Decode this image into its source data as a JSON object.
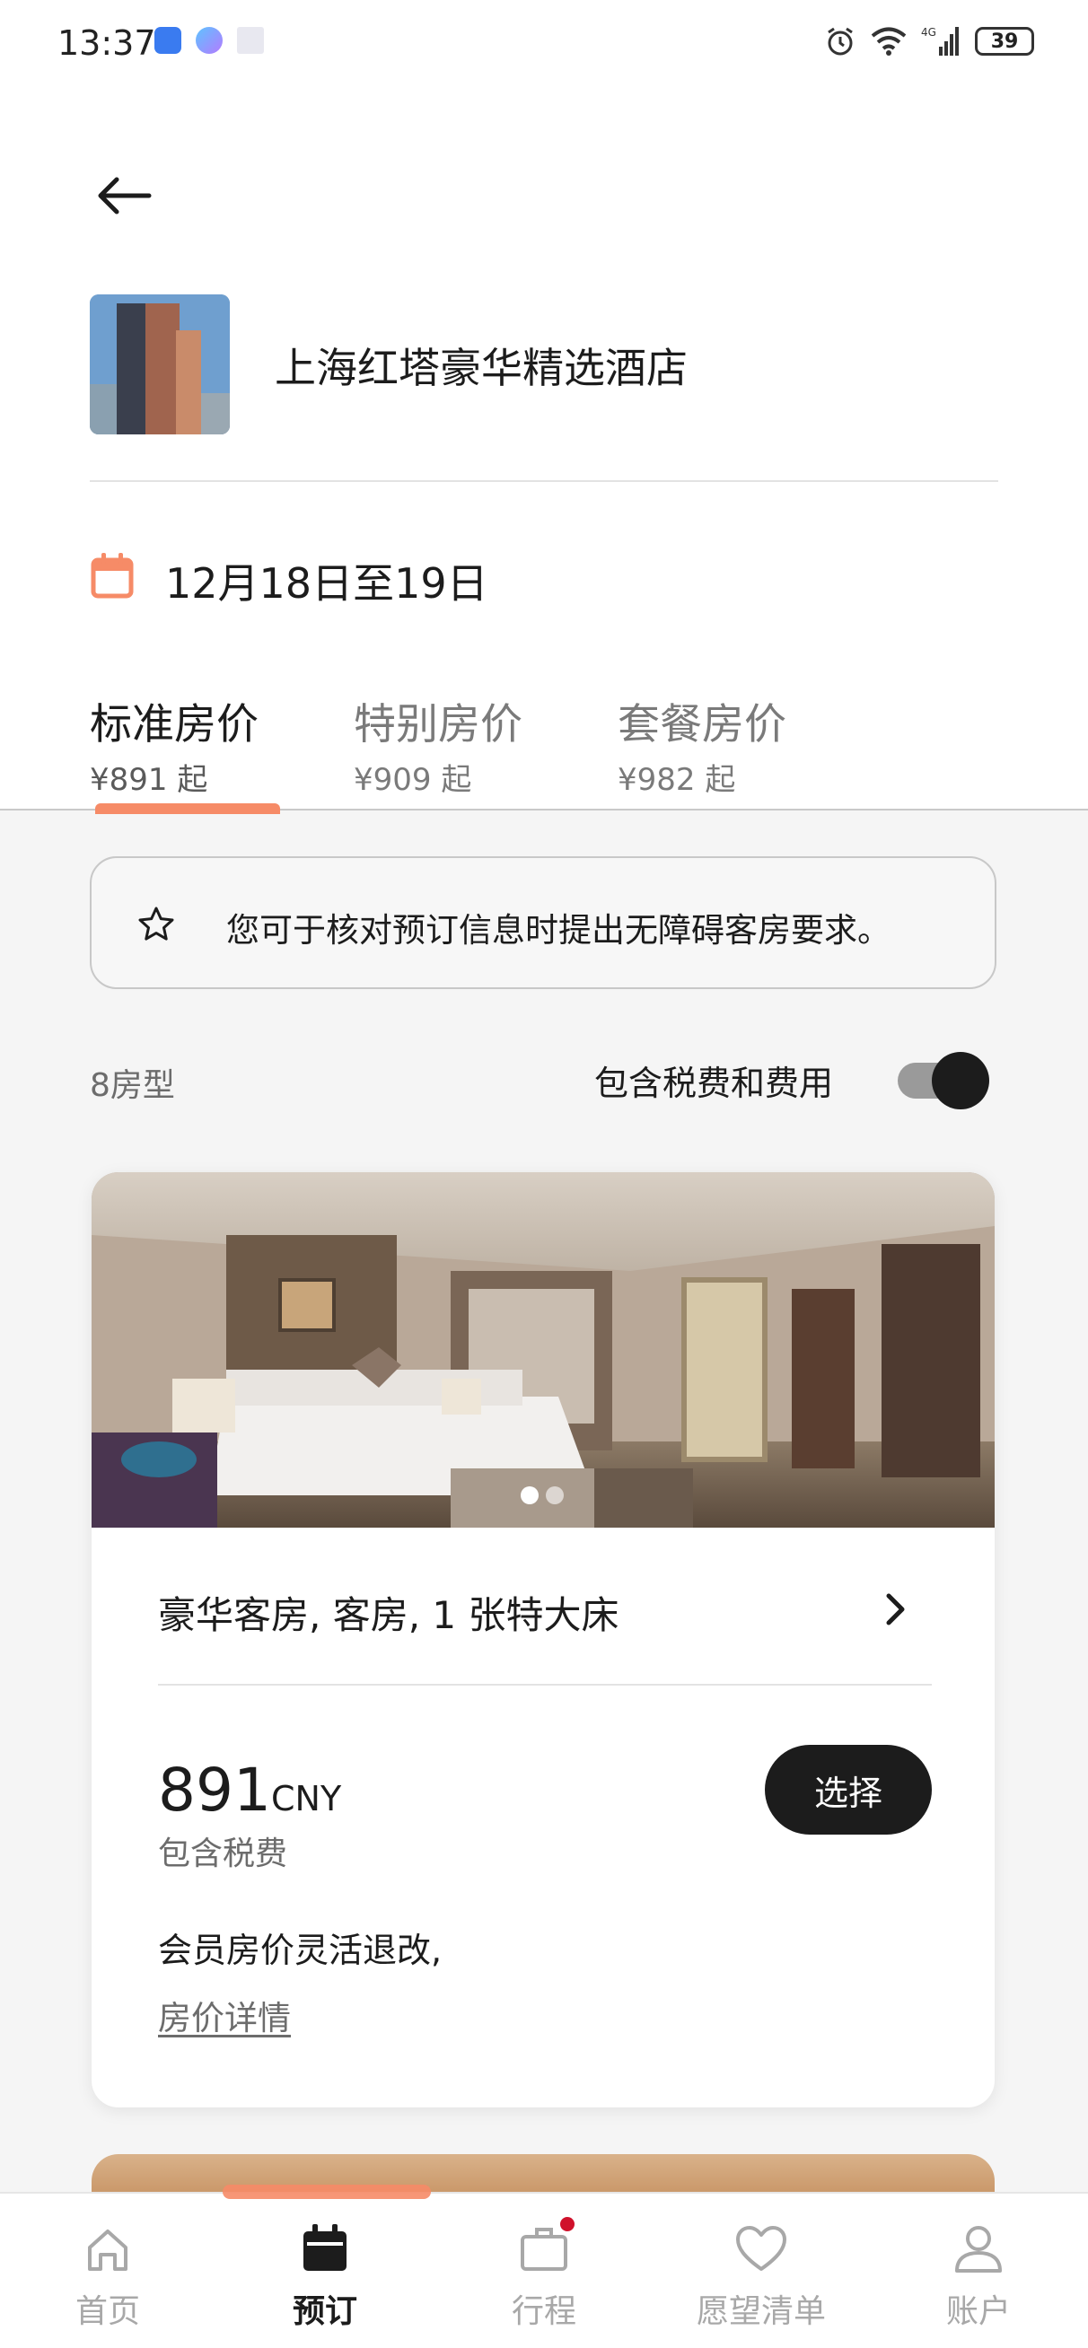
{
  "status_bar": {
    "time": "13:37",
    "battery": "39",
    "network": "4G"
  },
  "hotel": {
    "name": "上海红塔豪华精选酒店"
  },
  "dates": {
    "label": "12月18日至19日"
  },
  "rate_tabs": [
    {
      "label": "标准房价",
      "price": "¥891 起",
      "active": true
    },
    {
      "label": "特别房价",
      "price": "¥909 起",
      "active": false
    },
    {
      "label": "套餐房价",
      "price": "¥982 起",
      "active": false
    }
  ],
  "notice": {
    "text": "您可于核对预订信息时提出无障碍客房要求。",
    "icon": "star-outline-icon"
  },
  "filters": {
    "room_count": "8房型",
    "tax_toggle_label": "包含税费和费用",
    "tax_toggle_on": true
  },
  "room": {
    "title": "豪华客房, 客房, 1 张特大床",
    "price": "891",
    "currency": "CNY",
    "price_note": "包含税费",
    "select_label": "选择",
    "policy": "会员房价灵活退改,",
    "details_link": "房价详情",
    "photo_count": 2,
    "photo_index": 1
  },
  "bottom_nav": [
    {
      "label": "首页",
      "icon": "home-icon",
      "active": false
    },
    {
      "label": "预订",
      "icon": "calendar-icon",
      "active": true
    },
    {
      "label": "行程",
      "icon": "suitcase-icon",
      "active": false,
      "badge": true
    },
    {
      "label": "愿望清单",
      "icon": "heart-icon",
      "active": false
    },
    {
      "label": "账户",
      "icon": "person-icon",
      "active": false
    }
  ],
  "colors": {
    "accent": "#f68b67",
    "primary_dark": "#1c1c1c",
    "badge_red": "#d0112b"
  }
}
